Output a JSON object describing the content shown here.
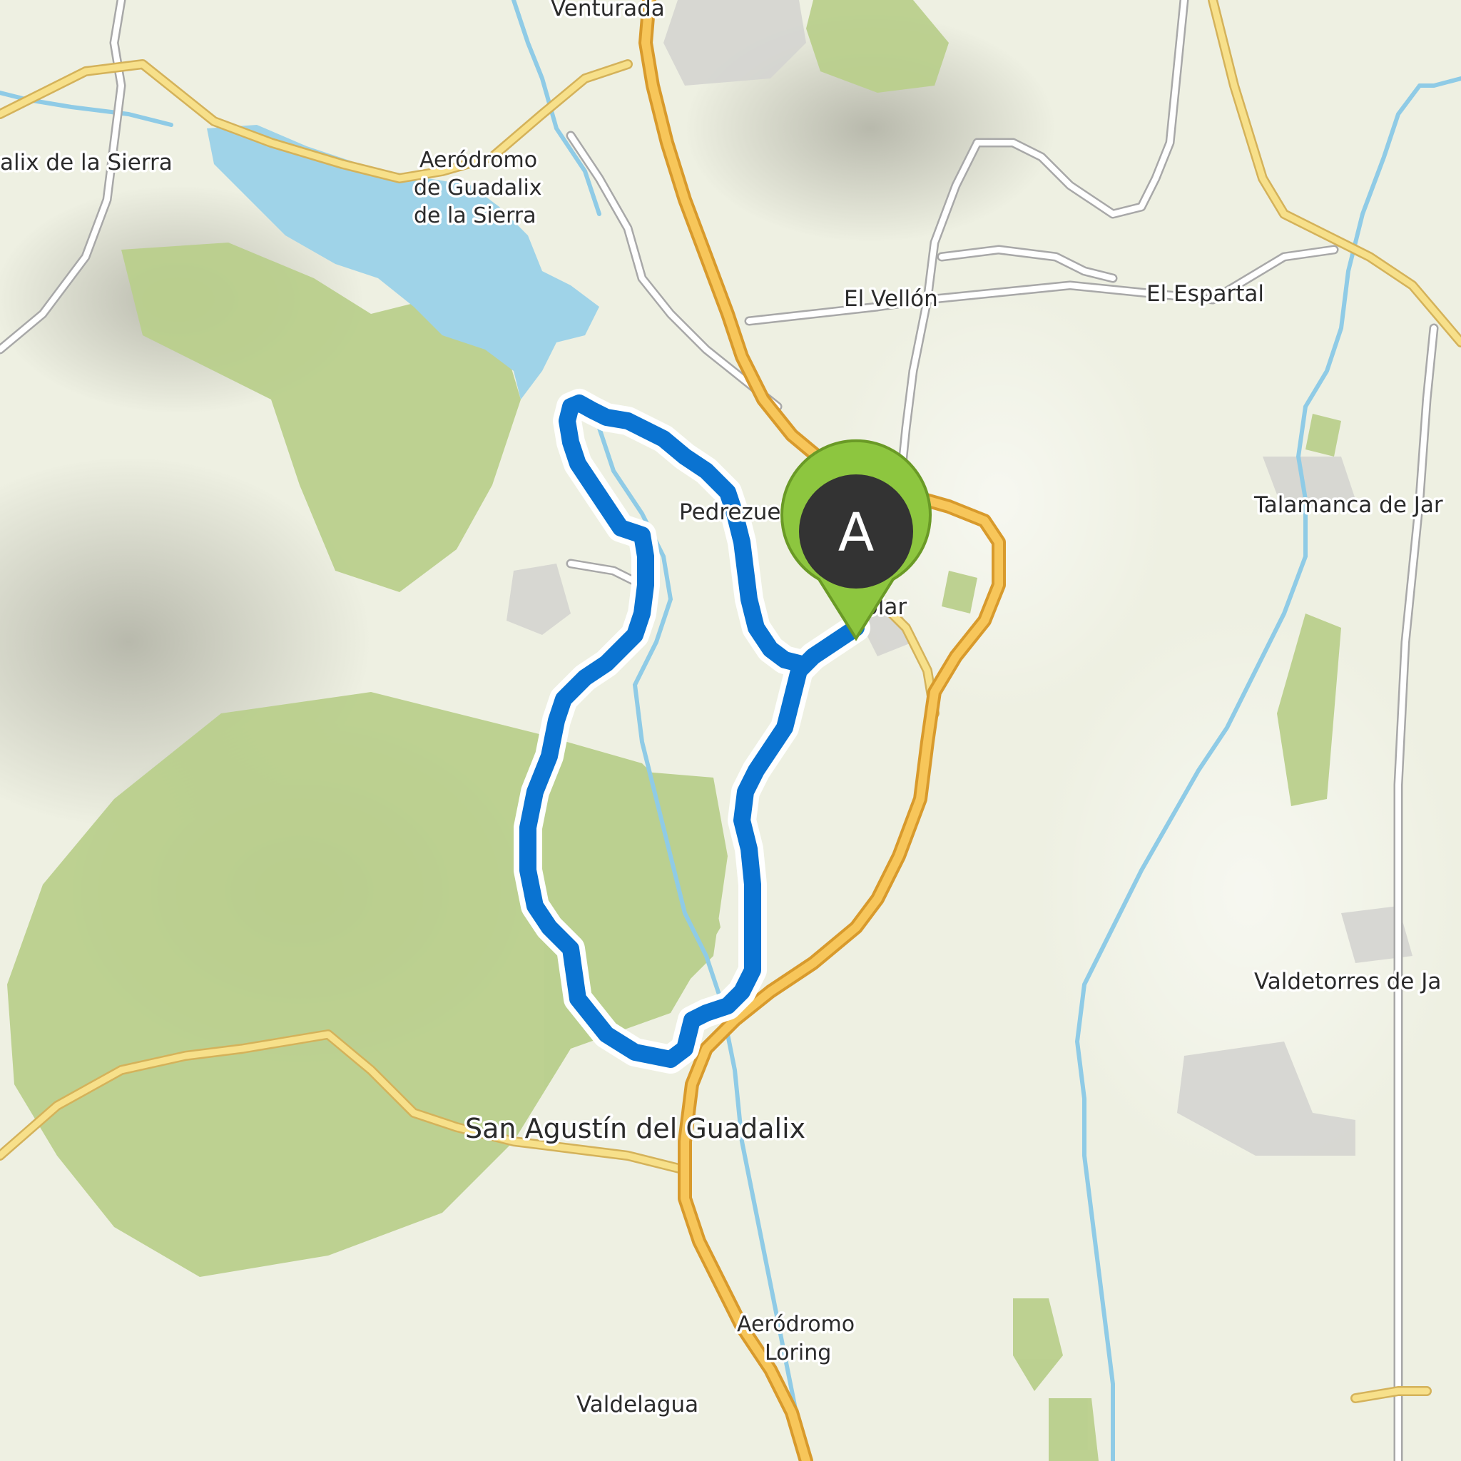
{
  "map": {
    "places": {
      "venturada": "Venturada",
      "guadalix": "alix de la Sierra",
      "aerodromo_guadalix_1": "Aeródromo",
      "aerodromo_guadalix_2": "de Guadalix",
      "aerodromo_guadalix_3": "de la Sierra",
      "el_vellon": "El Vellón",
      "el_espartal": "El Espartal",
      "talamanca": "Talamanca de Jar",
      "pedrezuela": "Pedrezuel",
      "molar": "Molar",
      "valdetorres": "Valdetorres de Ja",
      "san_agustin": "San Agustín del Guadalix",
      "aerodromo_loring_1": "Aeródromo",
      "aerodromo_loring_2": "Loring",
      "valdelagua": "Valdelagua"
    },
    "marker": {
      "letter": "A",
      "color": "#8dc63f"
    },
    "colors": {
      "route": "#0a73d1",
      "water": "#9fd3e8",
      "forest": "#b9cf8c",
      "motorway": "#f2c55c",
      "land": "#eef0e2"
    }
  }
}
